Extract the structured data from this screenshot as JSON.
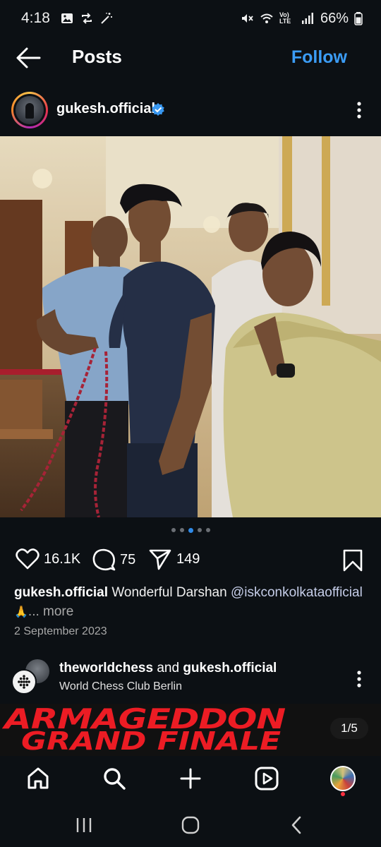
{
  "status_bar": {
    "time": "4:18",
    "battery": "66%",
    "network_label": "Vo) LTE"
  },
  "header": {
    "title": "Posts",
    "follow_label": "Follow"
  },
  "post": {
    "username": "gukesh.official",
    "verified": true,
    "likes": "16.1K",
    "comments": "75",
    "shares": "149",
    "caption_username": "gukesh.official",
    "caption_text": "Wonderful Darshan",
    "caption_mention": "@iskconkolkataofficial",
    "caption_emoji": "🙏",
    "more_label": "... more",
    "date": "2 September 2023",
    "carousel_dots": 5,
    "active_dot": 2
  },
  "next_post": {
    "user1": "theworldchess",
    "connector": "and",
    "user2": "gukesh.official",
    "location": "World Chess Club Berlin",
    "banner_line1": "ARMAGEDDON",
    "banner_line2": "GRAND FINALE",
    "slide_counter": "1/5"
  },
  "colors": {
    "background": "#0c1014",
    "accent_blue": "#3b9cf5",
    "banner_red": "#ec1c24",
    "notification_red": "#ff3040"
  },
  "icons": [
    "back-arrow-icon",
    "verified-badge-icon",
    "more-vertical-icon",
    "heart-icon",
    "comment-icon",
    "share-icon",
    "bookmark-icon",
    "home-icon",
    "search-icon",
    "create-icon",
    "reels-icon",
    "profile-avatar"
  ]
}
